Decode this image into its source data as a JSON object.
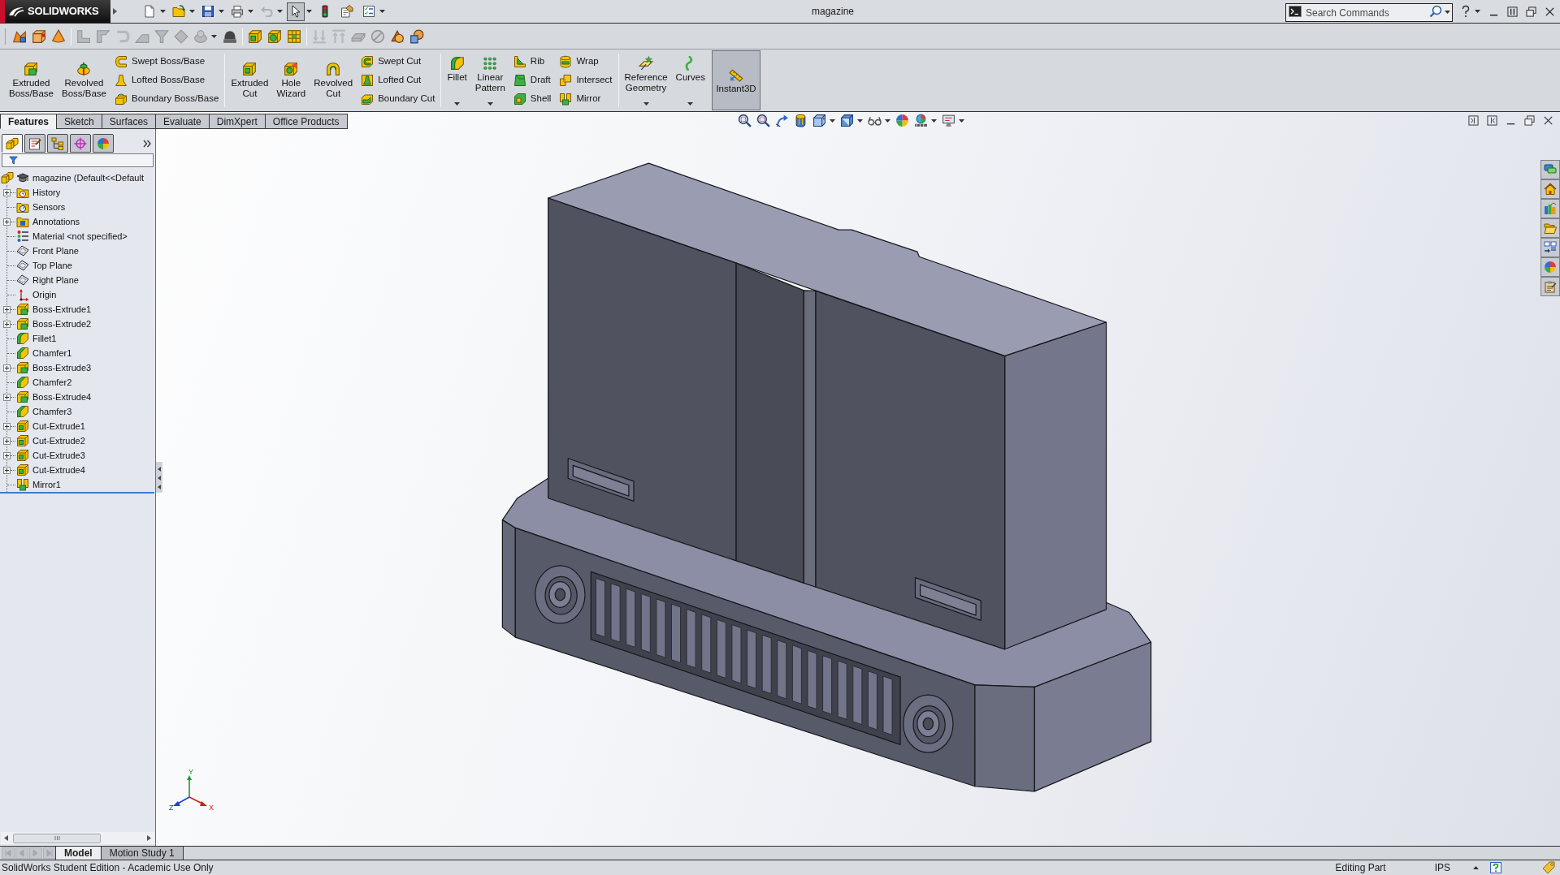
{
  "title_bar": {
    "logo": "SOLIDWORKS",
    "title": "magazine",
    "search": {
      "placeholder": "Search Commands"
    }
  },
  "quick_access": [
    {
      "pressed": false,
      "disabled": false
    },
    {
      "pressed": false,
      "disabled": false
    },
    {
      "pressed": false,
      "disabled": false
    },
    {
      "pressed": false,
      "disabled": false
    },
    {
      "pressed": false,
      "disabled": true
    },
    {
      "pressed": true,
      "disabled": false
    },
    {
      "pressed": false,
      "disabled": false
    },
    {
      "pressed": false,
      "disabled": false
    },
    {
      "pressed": false,
      "disabled": false
    }
  ],
  "toolbar": [
    {
      "disabled": false
    },
    {
      "disabled": false
    },
    {
      "disabled": false
    },
    {
      "disabled": true
    },
    {
      "disabled": true
    },
    {
      "disabled": true
    },
    {
      "disabled": true
    },
    {
      "disabled": true
    },
    {
      "disabled": true
    },
    {
      "disabled": true
    },
    {
      "disabled": false
    },
    {
      "disabled": false
    },
    {
      "disabled": false
    },
    {
      "disabled": false
    },
    {
      "disabled": true
    },
    {
      "disabled": true
    },
    {
      "disabled": true
    },
    {
      "disabled": true
    },
    {
      "disabled": false
    },
    {
      "disabled": false
    }
  ],
  "ribbon": {
    "groups": [
      {
        "items": [
          {
            "kind": "large",
            "label": "Extruded Boss/Base",
            "pressed": false
          },
          {
            "kind": "large",
            "label": "Revolved Boss/Base",
            "pressed": false
          },
          {
            "kind": "stack",
            "items": [
              "Swept Boss/Base",
              "Lofted Boss/Base",
              "Boundary Boss/Base"
            ]
          }
        ]
      },
      {
        "items": [
          {
            "kind": "large",
            "label": "Extruded Cut",
            "pressed": false
          },
          {
            "kind": "large",
            "label": "Hole Wizard",
            "pressed": false
          },
          {
            "kind": "large",
            "label": "Revolved Cut",
            "pressed": false
          },
          {
            "kind": "stack",
            "items": [
              "Swept Cut",
              "Lofted Cut",
              "Boundary Cut"
            ]
          }
        ]
      },
      {
        "items": [
          {
            "kind": "large",
            "label": "Fillet",
            "pressed": false,
            "dropdown": true
          },
          {
            "kind": "large",
            "label": "Linear Pattern",
            "pressed": false,
            "dropdown": true
          },
          {
            "kind": "stack",
            "items": [
              "Rib",
              "Draft",
              "Shell"
            ]
          },
          {
            "kind": "stack",
            "items": [
              "Wrap",
              "Intersect",
              "Mirror"
            ]
          }
        ]
      },
      {
        "items": [
          {
            "kind": "large",
            "label": "Reference Geometry",
            "pressed": false,
            "dropdown": true
          },
          {
            "kind": "large",
            "label": "Curves",
            "pressed": false,
            "dropdown": true
          },
          {
            "kind": "large",
            "label": "Instant3D",
            "pressed": true
          }
        ]
      }
    ]
  },
  "command_tabs": [
    {
      "label": "Features",
      "selected": true
    },
    {
      "label": "Sketch",
      "selected": false
    },
    {
      "label": "Surfaces",
      "selected": false
    },
    {
      "label": "Evaluate",
      "selected": false
    },
    {
      "label": "DimXpert",
      "selected": false
    },
    {
      "label": "Office Products",
      "selected": false
    }
  ],
  "feature_manager": {
    "tabs": [
      {
        "selected": true
      },
      {
        "selected": false
      },
      {
        "selected": false
      },
      {
        "selected": false
      },
      {
        "selected": false
      }
    ],
    "tree": {
      "label": "magazine (Default<<Default",
      "kind": "part",
      "children": [
        {
          "label": "History",
          "kind": "history",
          "expanded": false
        },
        {
          "label": "Sensors",
          "kind": "sensors"
        },
        {
          "label": "Annotations",
          "kind": "annotations",
          "expanded": false
        },
        {
          "label": "Material <not specified>",
          "kind": "material"
        },
        {
          "label": "Front Plane",
          "kind": "plane"
        },
        {
          "label": "Top Plane",
          "kind": "plane"
        },
        {
          "label": "Right Plane",
          "kind": "plane"
        },
        {
          "label": "Origin",
          "kind": "origin"
        },
        {
          "label": "Boss-Extrude1",
          "kind": "boss",
          "expanded": false
        },
        {
          "label": "Boss-Extrude2",
          "kind": "boss",
          "expanded": false
        },
        {
          "label": "Fillet1",
          "kind": "fillet"
        },
        {
          "label": "Chamfer1",
          "kind": "chamfer"
        },
        {
          "label": "Boss-Extrude3",
          "kind": "boss",
          "expanded": false
        },
        {
          "label": "Chamfer2",
          "kind": "chamfer"
        },
        {
          "label": "Boss-Extrude4",
          "kind": "boss",
          "expanded": false
        },
        {
          "label": "Chamfer3",
          "kind": "chamfer"
        },
        {
          "label": "Cut-Extrude1",
          "kind": "cut",
          "expanded": false
        },
        {
          "label": "Cut-Extrude2",
          "kind": "cut",
          "expanded": false
        },
        {
          "label": "Cut-Extrude3",
          "kind": "cut",
          "expanded": false
        },
        {
          "label": "Cut-Extrude4",
          "kind": "cut",
          "expanded": false
        },
        {
          "label": "Mirror1",
          "kind": "mirror"
        }
      ]
    }
  },
  "axis_triad": {
    "labels": [
      "Y",
      "Z",
      "X"
    ]
  },
  "bottom_tabs": [
    {
      "label": "Model",
      "selected": true
    },
    {
      "label": "Motion Study 1",
      "selected": false
    }
  ],
  "status_bar": {
    "message": "SolidWorks Student Edition - Academic Use Only",
    "mode": "Editing Part",
    "units": "IPS"
  }
}
